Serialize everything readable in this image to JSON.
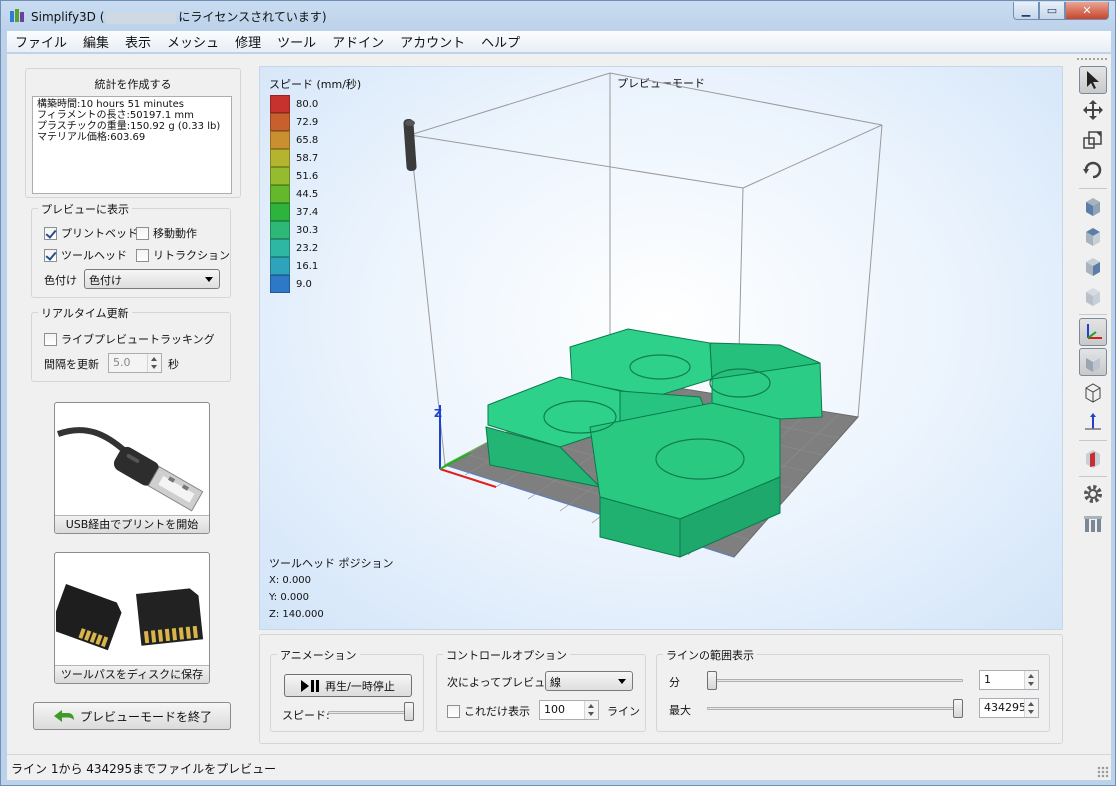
{
  "window": {
    "title_prefix": "Simplify3D (",
    "title_suffix": "にライセンスされています)"
  },
  "menu": [
    "ファイル",
    "編集",
    "表示",
    "メッシュ",
    "修理",
    "ツール",
    "アドイン",
    "アカウント",
    "ヘルプ"
  ],
  "stats": {
    "title": "統計を作成する",
    "lines": [
      "構築時間:10 hours 51 minutes",
      "フィラメントの長さ:50197.1 mm",
      "プラスチックの重量:150.92 g (0.33 lb)",
      "マテリアル価格:603.69"
    ]
  },
  "preview_options": {
    "label": "プレビューに表示",
    "print_bed": {
      "label": "プリントベッド",
      "checked": true
    },
    "travel": {
      "label": "移動動作",
      "checked": false
    },
    "tool_head": {
      "label": "ツールヘッド",
      "checked": true
    },
    "retraction": {
      "label": "リトラクション",
      "checked": false
    },
    "coloring_label": "色付け",
    "coloring_value": "色付け"
  },
  "realtime": {
    "label": "リアルタイム更新",
    "live_tracking": {
      "label": "ライブプレビュートラッキング",
      "checked": false
    },
    "interval_label": "間隔を更新",
    "interval_value": "5.0",
    "interval_unit": "秒"
  },
  "buttons": {
    "usb_print": "USB経由でプリントを開始",
    "save_toolpath": "ツールパスをディスクに保存",
    "exit_preview": "プレビューモードを終了"
  },
  "viewport": {
    "mode_title": "プレビューモード",
    "legend_title": "スピード (mm/秒)",
    "legend": [
      {
        "value": "80.0",
        "color": "#c8322e"
      },
      {
        "value": "72.9",
        "color": "#c8602e"
      },
      {
        "value": "65.8",
        "color": "#c8902e"
      },
      {
        "value": "58.7",
        "color": "#b4b42e"
      },
      {
        "value": "51.6",
        "color": "#94bc2e"
      },
      {
        "value": "44.5",
        "color": "#64b82e"
      },
      {
        "value": "37.4",
        "color": "#2eb43c"
      },
      {
        "value": "30.3",
        "color": "#2eb878"
      },
      {
        "value": "23.2",
        "color": "#2eb8a4"
      },
      {
        "value": "16.1",
        "color": "#2ea4bc"
      },
      {
        "value": "9.0",
        "color": "#2e78c8"
      }
    ],
    "axis_z": "Z",
    "tool_position": {
      "header": "ツールヘッド ポジション",
      "x": "X: 0.000",
      "y": "Y: 0.000",
      "z": "Z: 140.000"
    }
  },
  "animation": {
    "label": "アニメーション",
    "play_pause": "再生/一時停止",
    "speed_label": "スピード:",
    "speed_fraction": 1.0
  },
  "control_options": {
    "label": "コントロールオプション",
    "preview_by_label": "次によってプレビュー",
    "preview_by_value": "線",
    "show_only_label": "これだけ表示",
    "show_only_checked": false,
    "show_only_value": "100",
    "show_only_unit": "ライン"
  },
  "line_range": {
    "label": "ラインの範囲表示",
    "min_label": "分",
    "min_value": "1",
    "max_label": "最大",
    "max_value": "434295"
  },
  "status": "ライン 1から 434295までファイルをプレビュー"
}
